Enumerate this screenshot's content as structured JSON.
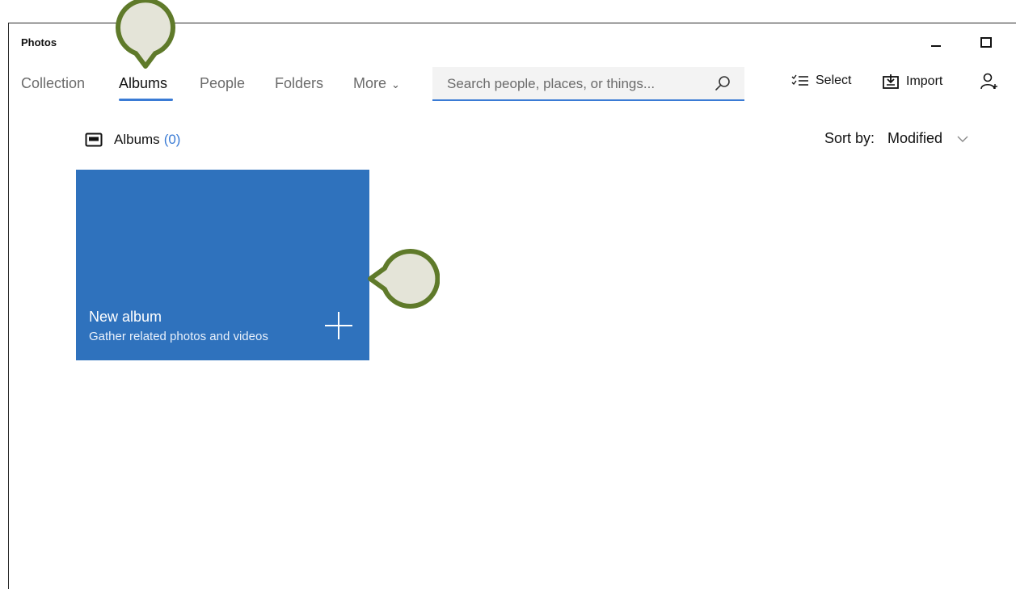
{
  "window": {
    "title": "Photos"
  },
  "nav": {
    "tabs": [
      {
        "label": "Collection",
        "active": false
      },
      {
        "label": "Albums",
        "active": true
      },
      {
        "label": "People",
        "active": false
      },
      {
        "label": "Folders",
        "active": false
      },
      {
        "label": "More",
        "active": false
      }
    ]
  },
  "search": {
    "placeholder": "Search people, places, or things..."
  },
  "toolbar": {
    "select_label": "Select",
    "import_label": "Import"
  },
  "albums": {
    "heading": "Albums",
    "count": "(0)",
    "sort_label": "Sort by:",
    "sort_value": "Modified",
    "new_album_title": "New album",
    "new_album_subtitle": "Gather related photos and videos"
  },
  "colors": {
    "accent": "#3a7bd5",
    "tile": "#2f72bd",
    "callout_fill": "#e4e4d8",
    "callout_stroke": "#5f7a2a"
  }
}
